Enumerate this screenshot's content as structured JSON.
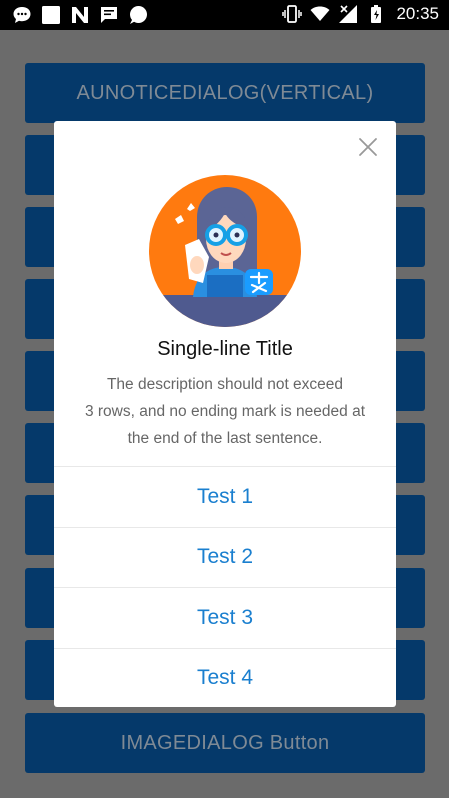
{
  "status_bar": {
    "time": "20:35",
    "left_icons": [
      "message-icon",
      "square-icon",
      "n-icon",
      "chat-icon",
      "bubble-icon"
    ],
    "right_icons": [
      "vibrate-icon",
      "wifi-icon",
      "signal-icon",
      "battery-icon"
    ]
  },
  "background": {
    "buttons": [
      {
        "label": "AUNOTICEDIALOG(VERTICAL)"
      },
      {
        "label": ""
      },
      {
        "label": ""
      },
      {
        "label": ""
      },
      {
        "label": ""
      },
      {
        "label": ""
      },
      {
        "label": ""
      },
      {
        "label": ""
      },
      {
        "label": ""
      },
      {
        "label": "IMAGEDIALOG  Button"
      }
    ],
    "button_color": "#05396a",
    "overlay_color": "#6b6b6b"
  },
  "dialog": {
    "close_icon": "close-icon",
    "illustration": "avatar-illustration",
    "title": "Single-line Title",
    "description_lines": [
      "The description should not exceed",
      "3 rows, and no ending mark is needed at",
      "the end of the last sentence."
    ],
    "actions": [
      {
        "label": "Test 1"
      },
      {
        "label": "Test 2"
      },
      {
        "label": "Test 3"
      },
      {
        "label": "Test 4"
      }
    ],
    "accent_color": "#1a7fcf"
  }
}
